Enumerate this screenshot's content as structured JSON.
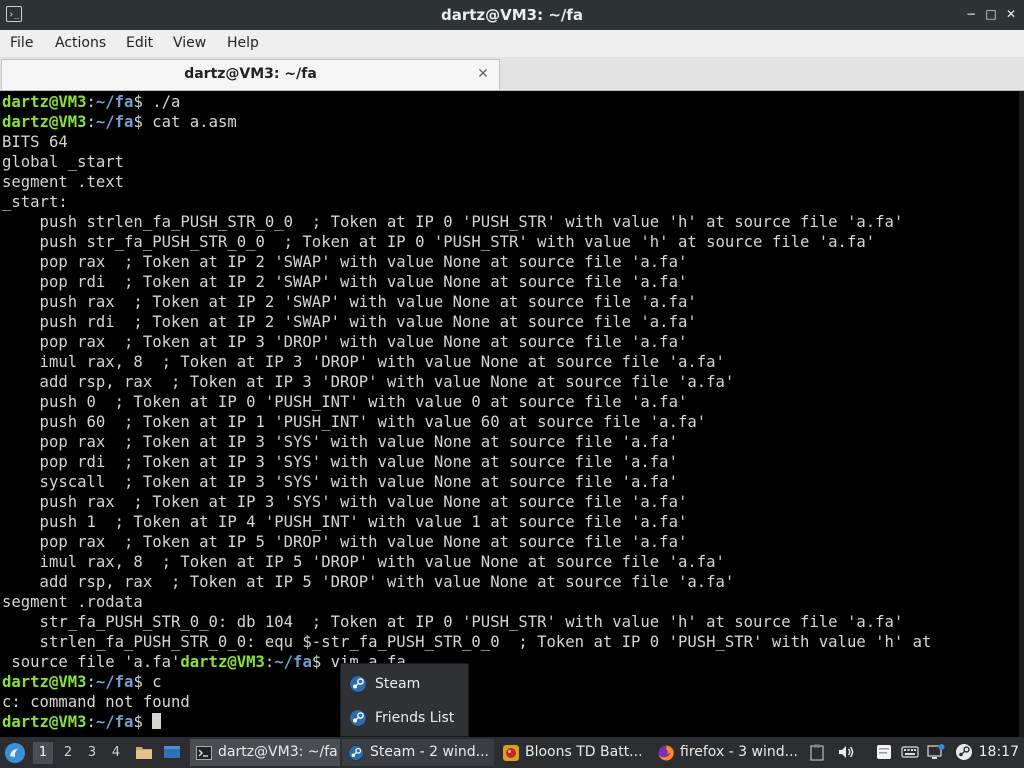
{
  "window": {
    "title": "dartz@VM3: ~/fa",
    "app_icon_glyph": "›_",
    "minimize_glyph": "−",
    "maximize_glyph": "□",
    "close_glyph": "✕"
  },
  "menu": {
    "file": "File",
    "actions": "Actions",
    "edit": "Edit",
    "view": "View",
    "help": "Help"
  },
  "tab": {
    "label": "dartz@VM3: ~/fa",
    "close_glyph": "✕"
  },
  "prompt": {
    "user": "dartz@VM3",
    "sep": ":",
    "path": "~/fa",
    "dollar": "$ "
  },
  "terminal": {
    "cmd_run": "./a",
    "cmd_cat": "cat a.asm",
    "asm_lines": [
      "BITS 64",
      "global _start",
      "segment .text",
      "_start:",
      "    push strlen_fa_PUSH_STR_0_0  ; Token at IP 0 'PUSH_STR' with value 'h' at source file 'a.fa'",
      "    push str_fa_PUSH_STR_0_0  ; Token at IP 0 'PUSH_STR' with value 'h' at source file 'a.fa'",
      "    pop rax  ; Token at IP 2 'SWAP' with value None at source file 'a.fa'",
      "    pop rdi  ; Token at IP 2 'SWAP' with value None at source file 'a.fa'",
      "    push rax  ; Token at IP 2 'SWAP' with value None at source file 'a.fa'",
      "    push rdi  ; Token at IP 2 'SWAP' with value None at source file 'a.fa'",
      "    pop rax  ; Token at IP 3 'DROP' with value None at source file 'a.fa'",
      "    imul rax, 8  ; Token at IP 3 'DROP' with value None at source file 'a.fa'",
      "    add rsp, rax  ; Token at IP 3 'DROP' with value None at source file 'a.fa'",
      "    push 0  ; Token at IP 0 'PUSH_INT' with value 0 at source file 'a.fa'",
      "    push 60  ; Token at IP 1 'PUSH_INT' with value 60 at source file 'a.fa'",
      "    pop rax  ; Token at IP 3 'SYS' with value None at source file 'a.fa'",
      "    pop rdi  ; Token at IP 3 'SYS' with value None at source file 'a.fa'",
      "    syscall  ; Token at IP 3 'SYS' with value None at source file 'a.fa'",
      "    push rax  ; Token at IP 3 'SYS' with value None at source file 'a.fa'",
      "    push 1  ; Token at IP 4 'PUSH_INT' with value 1 at source file 'a.fa'",
      "    pop rax  ; Token at IP 5 'DROP' with value None at source file 'a.fa'",
      "    imul rax, 8  ; Token at IP 5 'DROP' with value None at source file 'a.fa'",
      "    add rsp, rax  ; Token at IP 5 'DROP' with value None at source file 'a.fa'",
      "segment .rodata",
      "    str_fa_PUSH_STR_0_0: db 104  ; Token at IP 0 'PUSH_STR' with value 'h' at source file 'a.fa'",
      "    strlen_fa_PUSH_STR_0_0: equ $-str_fa_PUSH_STR_0_0  ; Token at IP 0 'PUSH_STR' with value 'h' at"
    ],
    "wrap_tail": " source file 'a.fa'",
    "cmd_vim": "vim a.fa",
    "cmd_c": "c",
    "error_line": "c: command not found"
  },
  "popup": {
    "items": [
      "Steam",
      "Friends List"
    ]
  },
  "taskbar": {
    "workspaces": [
      "1",
      "2",
      "3",
      "4"
    ],
    "tasks": [
      {
        "label": "dartz@VM3: ~/fa"
      },
      {
        "label": "Steam - 2 wind..."
      },
      {
        "label": "Bloons TD Batt..."
      },
      {
        "label": "firefox - 3 wind..."
      }
    ],
    "clock": "18:17"
  }
}
